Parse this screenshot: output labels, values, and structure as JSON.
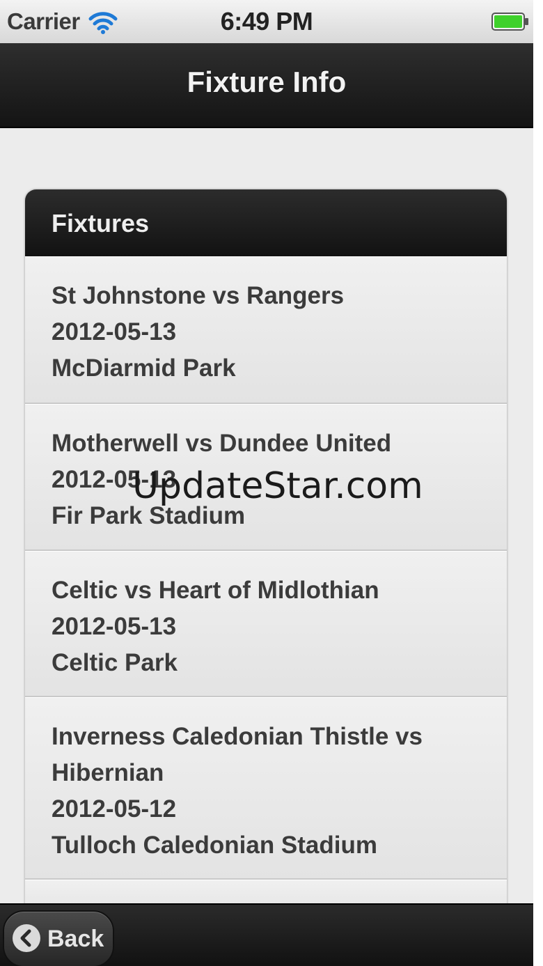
{
  "status_bar": {
    "carrier": "Carrier",
    "time": "6:49 PM",
    "wifi_icon": "wifi-icon",
    "battery_icon": "battery-icon",
    "battery_color": "#3fd12b"
  },
  "nav_bar": {
    "title": "Fixture Info"
  },
  "fixtures": {
    "header": "Fixtures",
    "items": [
      {
        "match": "St Johnstone vs Rangers",
        "date": "2012-05-13",
        "venue": "McDiarmid Park"
      },
      {
        "match": "Motherwell vs Dundee United",
        "date": "2012-05-13",
        "venue": "Fir Park Stadium"
      },
      {
        "match": "Celtic vs Heart of Midlothian",
        "date": "2012-05-13",
        "venue": "Celtic Park"
      },
      {
        "match": "Inverness Caledonian Thistle vs Hibernian",
        "date": "2012-05-12",
        "venue": "Tulloch Caledonian Stadium"
      }
    ]
  },
  "toolbar": {
    "back_label": "Back",
    "back_icon": "chevron-left-icon"
  },
  "watermark": "UpdateStar.com",
  "colors": {
    "nav_bar": "#1c1c1c",
    "list_background": "#e8e8e8",
    "text": "#3b3b3b"
  }
}
